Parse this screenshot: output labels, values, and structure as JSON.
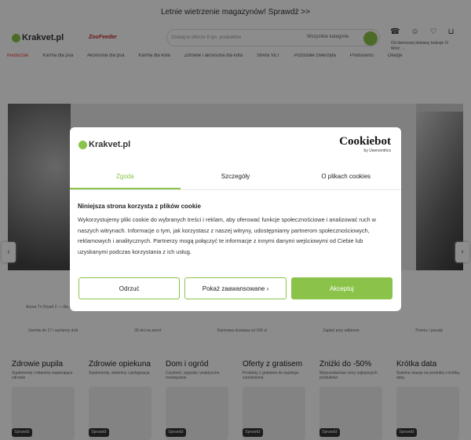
{
  "promo": "Letnie wietrzenie magazynów! Sprawdź >>",
  "header": {
    "logo": "Krakvet.pl",
    "logo2": "ZooFeeder",
    "search_placeholder": "Szukaj w ofercie 6 tys. produktów",
    "search_category": "Wszystkie kategorie",
    "icons": [
      "phone-icon",
      "user-icon",
      "heart-icon",
      "cart-icon"
    ],
    "sub1": "Od darmowej dostawy brakuje Ci",
    "sub2": "Wróć →"
  },
  "nav": [
    "Kiedsczak",
    "Karma dla psa",
    "Akcesoria dla psa",
    "Karma dla kota",
    "Zdrowie i akcesoria dla kota",
    "Strefa VET",
    "Pozostałe zwierzęta",
    "Producenci",
    "Okazje"
  ],
  "hero_caption": "Aurea Tn Dryad 2 — dla psa",
  "features": [
    "Zamów do 17 i wyślemy dziś",
    "30 dni na zwrot",
    "Darmowa dostawa od 199 zł",
    "Zapłać przy odbiorze",
    "Pomoc i porady"
  ],
  "cards": [
    {
      "title": "Zdrowie pupila",
      "desc": "Suplementy i witaminy wspierające zdrowie"
    },
    {
      "title": "Zdrowie opiekuna",
      "desc": "Suplementy, witaminy i pielęgnacja"
    },
    {
      "title": "Dom i ogród",
      "desc": "Czystość, wygoda i praktyczne rozwiązania"
    },
    {
      "title": "Oferty z gratisem",
      "desc": "Produkty z gratisem do każdego zamówienia"
    },
    {
      "title": "Zniżki do -50%",
      "desc": "Wyprzedażowe ceny najlepszych produktów"
    },
    {
      "title": "Krótka data",
      "desc": "Świetne okazje na produkty z krótką datą"
    }
  ],
  "card_button": "Sprawdź",
  "modal": {
    "logo": "Krakvet.pl",
    "cookiebot": "Cookiebot",
    "cookiebot_sub": "by Usercentrics",
    "tabs": [
      "Zgoda",
      "Szczegóły",
      "O plikach cookies"
    ],
    "heading": "Niniejsza strona korzysta z plików cookie",
    "body": "Wykorzystujemy pliki cookie do wybranych treści i reklam, aby oferować funkcje społecznościowe i analizować ruch w naszych witrynach. Informacje o tym, jak korzystasz z naszej witryny, udostępniamy partnerom społecznościowych, reklamowych i analitycznych. Partnerzy mogą połączyć te informacje z innymi danymi wejściowymi od Ciebie lub uzyskanymi podczas korzystania z ich usług.",
    "btn_reject": "Odrzuć",
    "btn_advanced": "Pokaż zaawansowane",
    "btn_accept": "Akceptuj"
  },
  "colors": {
    "accent": "#8bc34a"
  }
}
